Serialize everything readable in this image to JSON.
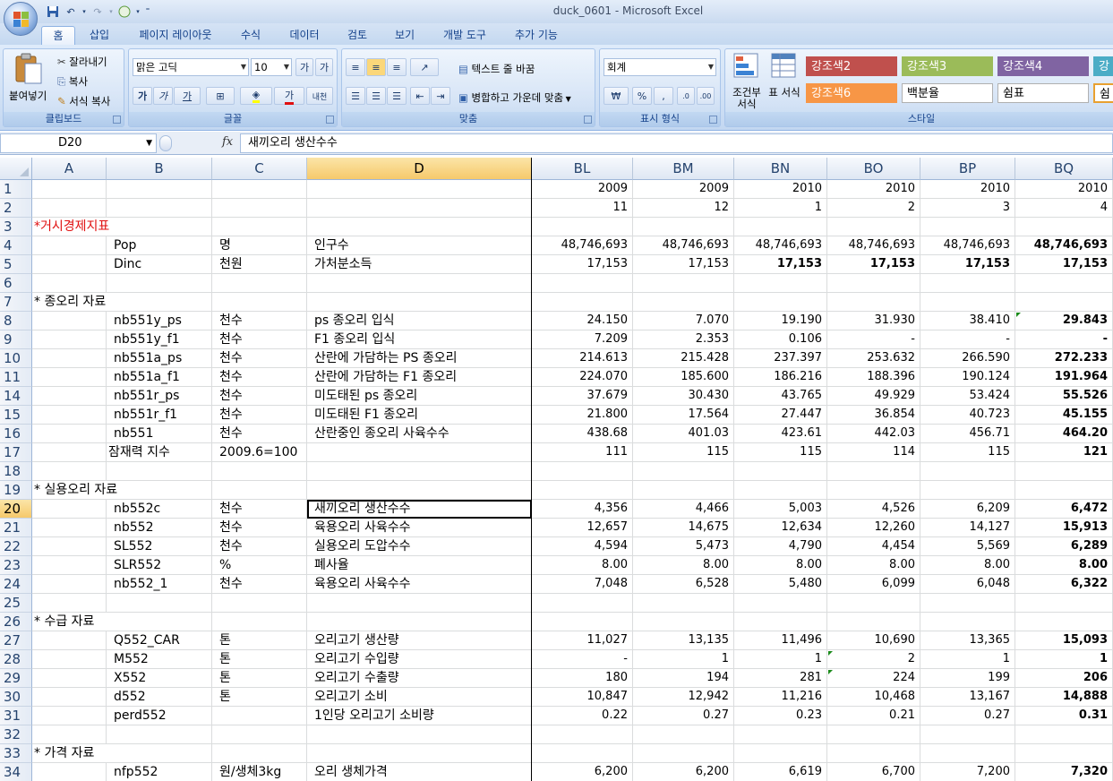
{
  "window": {
    "title": "duck_0601 - Microsoft Excel"
  },
  "ribbon": {
    "tabs": [
      "홈",
      "삽입",
      "페이지 레이아웃",
      "수식",
      "데이터",
      "검토",
      "보기",
      "개발 도구",
      "추가 기능"
    ],
    "active_tab": "홈",
    "clipboard": {
      "paste": "붙여넣기",
      "cut": "잘라내기",
      "copy": "복사",
      "format_painter": "서식 복사",
      "label": "클립보드"
    },
    "font": {
      "name": "맑은 고딕",
      "size": "10",
      "label": "글꼴",
      "bold": "가",
      "italic": "가",
      "underline": "가"
    },
    "alignment": {
      "wrap": "텍스트 줄 바꿈",
      "merge": "병합하고 가운데 맞춤",
      "label": "맞춤"
    },
    "number": {
      "format": "회계",
      "label": "표시 형식",
      "currency": "₩",
      "percent": "%",
      "comma": ","
    },
    "styles": {
      "conditional": "조건부 서식",
      "table": "표 서식",
      "label": "스타일",
      "cells": [
        "강조색2",
        "강조색3",
        "강조색4",
        "강조색6",
        "백분율",
        "쉼표",
        "강조",
        "쉼표"
      ]
    },
    "colors": {
      "accent2": "#c0504d",
      "accent3": "#9bbb59",
      "accent4": "#8064a2",
      "accent5": "#4bacc6",
      "accent6": "#f79646"
    }
  },
  "formula_bar": {
    "name_box": "D20",
    "fx": "fx",
    "content": "새끼오리 생산수수"
  },
  "columns": [
    "A",
    "B",
    "C",
    "D",
    "BL",
    "BM",
    "BN",
    "BO",
    "BP",
    "BQ"
  ],
  "selected": {
    "column": "D",
    "row": "20"
  },
  "rows": [
    {
      "n": "1",
      "a": "",
      "b": "",
      "c": "",
      "d": "",
      "v": [
        "2009",
        "2009",
        "2010",
        "2010",
        "2010",
        "2010"
      ]
    },
    {
      "n": "2",
      "a": "",
      "b": "",
      "c": "",
      "d": "",
      "v": [
        "11",
        "12",
        "1",
        "2",
        "3",
        "4"
      ]
    },
    {
      "n": "3",
      "a": "*거시경제지표",
      "b": "",
      "c": "",
      "d": "",
      "v": [
        "",
        "",
        "",
        "",
        "",
        ""
      ]
    },
    {
      "n": "4",
      "a": "",
      "b": "Pop",
      "c": "명",
      "d": "인구수",
      "v": [
        "48,746,693",
        "48,746,693",
        "48,746,693",
        "48,746,693",
        "48,746,693",
        "48,746,693"
      ]
    },
    {
      "n": "5",
      "a": "",
      "b": "Dinc",
      "c": "천원",
      "d": "가처분소득",
      "v": [
        "17,153",
        "17,153",
        "17,153",
        "17,153",
        "17,153",
        "17,153"
      ]
    },
    {
      "n": "6",
      "a": "",
      "b": "",
      "c": "",
      "d": "",
      "v": [
        "",
        "",
        "",
        "",
        "",
        ""
      ]
    },
    {
      "n": "7",
      "a": "* 종오리 자료",
      "b": "",
      "c": "",
      "d": "",
      "v": [
        "",
        "",
        "",
        "",
        "",
        ""
      ]
    },
    {
      "n": "8",
      "a": "",
      "b": "nb551y_ps",
      "c": "천수",
      "d": "ps 종오리 입식",
      "v": [
        "24.150",
        "7.070",
        "19.190",
        "31.930",
        "38.410",
        "29.843"
      ]
    },
    {
      "n": "9",
      "a": "",
      "b": "nb551y_f1",
      "c": "천수",
      "d": "F1 종오리 입식",
      "v": [
        "7.209",
        "2.353",
        "0.106",
        "-",
        "-",
        "-"
      ]
    },
    {
      "n": "10",
      "a": "",
      "b": "nb551a_ps",
      "c": "천수",
      "d": "산란에 가담하는 PS 종오리",
      "v": [
        "214.613",
        "215.428",
        "237.397",
        "253.632",
        "266.590",
        "272.233"
      ]
    },
    {
      "n": "11",
      "a": "",
      "b": "nb551a_f1",
      "c": "천수",
      "d": "산란에 가담하는 F1 종오리",
      "v": [
        "224.070",
        "185.600",
        "186.216",
        "188.396",
        "190.124",
        "191.964"
      ]
    },
    {
      "n": "14",
      "a": "",
      "b": "nb551r_ps",
      "c": "천수",
      "d": "미도태된 ps 종오리",
      "v": [
        "37.679",
        "30.430",
        "43.765",
        "49.929",
        "53.424",
        "55.526"
      ]
    },
    {
      "n": "15",
      "a": "",
      "b": "nb551r_f1",
      "c": "천수",
      "d": "미도태된 F1 종오리",
      "v": [
        "21.800",
        "17.564",
        "27.447",
        "36.854",
        "40.723",
        "45.155"
      ]
    },
    {
      "n": "16",
      "a": "",
      "b": "nb551",
      "c": "천수",
      "d": "산란중인 종오리 사육수수",
      "v": [
        "438.68",
        "401.03",
        "423.61",
        "442.03",
        "456.71",
        "464.20"
      ]
    },
    {
      "n": "17",
      "a": "",
      "b": "잠재력 지수",
      "c": "2009.6=100",
      "d": "",
      "v": [
        "111",
        "115",
        "115",
        "114",
        "115",
        "121"
      ]
    },
    {
      "n": "18",
      "a": "",
      "b": "",
      "c": "",
      "d": "",
      "v": [
        "",
        "",
        "",
        "",
        "",
        ""
      ]
    },
    {
      "n": "19",
      "a": "* 실용오리 자료",
      "b": "",
      "c": "",
      "d": "",
      "v": [
        "",
        "",
        "",
        "",
        "",
        ""
      ]
    },
    {
      "n": "20",
      "a": "",
      "b": "nb552c",
      "c": "천수",
      "d": "새끼오리 생산수수",
      "v": [
        "4,356",
        "4,466",
        "5,003",
        "4,526",
        "6,209",
        "6,472"
      ]
    },
    {
      "n": "21",
      "a": "",
      "b": "nb552",
      "c": "천수",
      "d": "육용오리 사육수수",
      "v": [
        "12,657",
        "14,675",
        "12,634",
        "12,260",
        "14,127",
        "15,913"
      ]
    },
    {
      "n": "22",
      "a": "",
      "b": "SL552",
      "c": "천수",
      "d": "실용오리 도압수수",
      "v": [
        "4,594",
        "5,473",
        "4,790",
        "4,454",
        "5,569",
        "6,289"
      ]
    },
    {
      "n": "23",
      "a": "",
      "b": "SLR552",
      "c": "%",
      "d": "폐사율",
      "v": [
        "8.00",
        "8.00",
        "8.00",
        "8.00",
        "8.00",
        "8.00"
      ]
    },
    {
      "n": "24",
      "a": "",
      "b": "nb552_1",
      "c": "천수",
      "d": "육용오리 사육수수",
      "v": [
        "7,048",
        "6,528",
        "5,480",
        "6,099",
        "6,048",
        "6,322"
      ]
    },
    {
      "n": "25",
      "a": "",
      "b": "",
      "c": "",
      "d": "",
      "v": [
        "",
        "",
        "",
        "",
        "",
        ""
      ]
    },
    {
      "n": "26",
      "a": "* 수급 자료",
      "b": "",
      "c": "",
      "d": "",
      "v": [
        "",
        "",
        "",
        "",
        "",
        ""
      ]
    },
    {
      "n": "27",
      "a": "",
      "b": "Q552_CAR",
      "c": "톤",
      "d": "오리고기 생산량",
      "v": [
        "11,027",
        "13,135",
        "11,496",
        "10,690",
        "13,365",
        "15,093"
      ]
    },
    {
      "n": "28",
      "a": "",
      "b": "M552",
      "c": "톤",
      "d": "오리고기 수입량",
      "v": [
        "-",
        "1",
        "1",
        "2",
        "1",
        "1"
      ]
    },
    {
      "n": "29",
      "a": "",
      "b": "X552",
      "c": "톤",
      "d": "오리고기 수출량",
      "v": [
        "180",
        "194",
        "281",
        "224",
        "199",
        "206"
      ]
    },
    {
      "n": "30",
      "a": "",
      "b": "d552",
      "c": "톤",
      "d": "오리고기 소비",
      "v": [
        "10,847",
        "12,942",
        "11,216",
        "10,468",
        "13,167",
        "14,888"
      ]
    },
    {
      "n": "31",
      "a": "",
      "b": "perd552",
      "c": "",
      "d": "1인당 오리고기 소비량",
      "v": [
        "0.22",
        "0.27",
        "0.23",
        "0.21",
        "0.27",
        "0.31"
      ]
    },
    {
      "n": "32",
      "a": "",
      "b": "",
      "c": "",
      "d": "",
      "v": [
        "",
        "",
        "",
        "",
        "",
        ""
      ]
    },
    {
      "n": "33",
      "a": "* 가격 자료",
      "b": "",
      "c": "",
      "d": "",
      "v": [
        "",
        "",
        "",
        "",
        "",
        ""
      ]
    },
    {
      "n": "34",
      "a": "",
      "b": "nfp552",
      "c": "원/생체3kg",
      "d": "오리 생체가격",
      "v": [
        "6,200",
        "6,200",
        "6,619",
        "6,700",
        "7,200",
        "7,320"
      ]
    }
  ]
}
